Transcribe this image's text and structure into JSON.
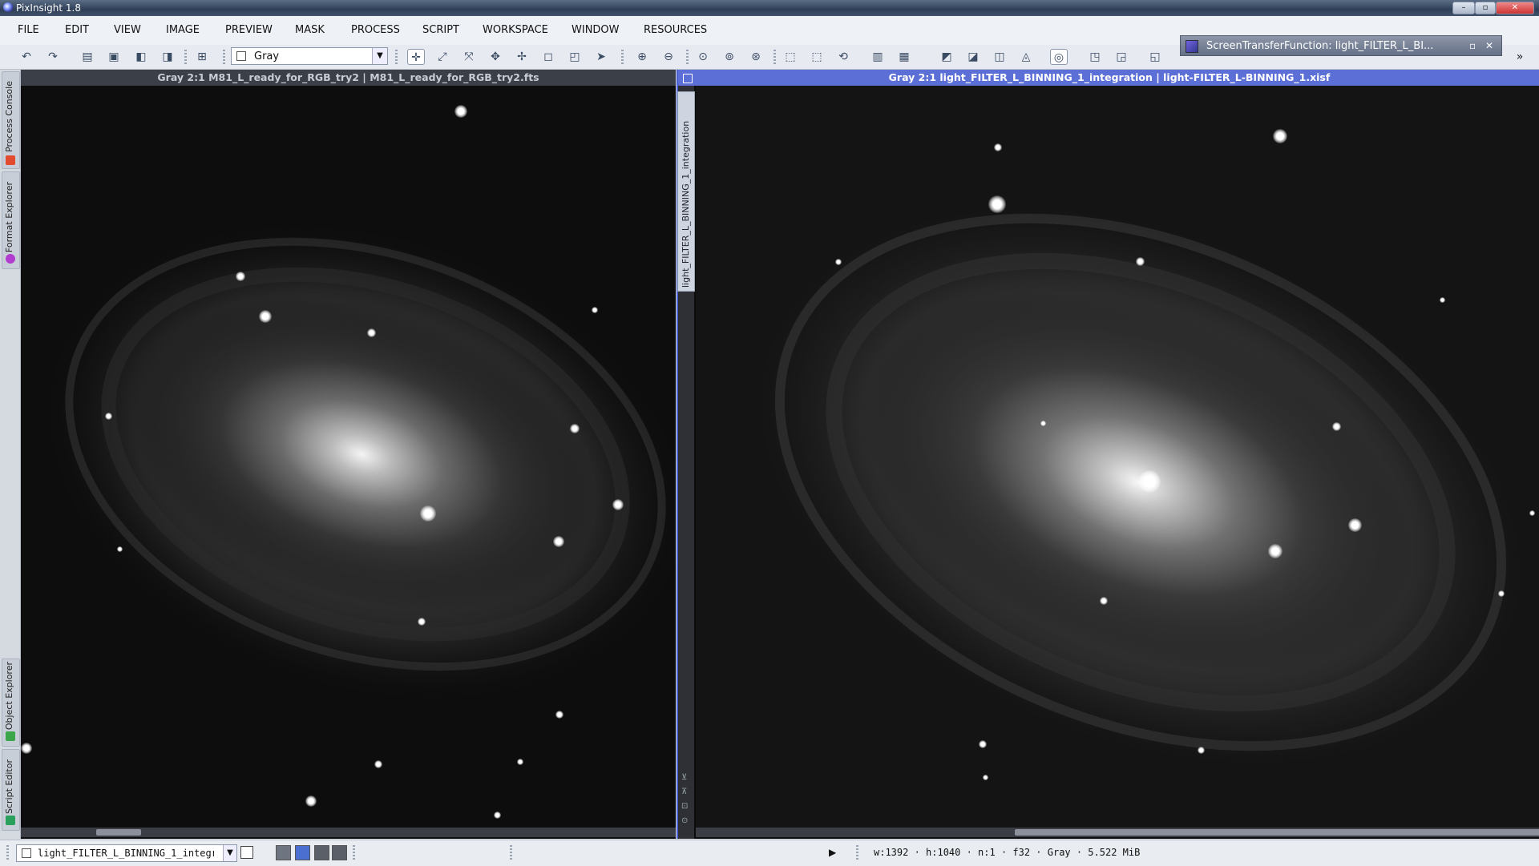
{
  "app": {
    "title": "PixInsight 1.8"
  },
  "window_controls": {
    "minimize": "–",
    "maximize": "▫",
    "close": "✕"
  },
  "menu": [
    "FILE",
    "EDIT",
    "VIEW",
    "IMAGE",
    "PREVIEW",
    "MASK",
    "PROCESS",
    "SCRIPT",
    "WORKSPACE",
    "WINDOW",
    "RESOURCES"
  ],
  "toolbar": {
    "color_mode_value": "Gray",
    "overflow": "»"
  },
  "stf_window": {
    "title": "ScreenTransferFunction: light_FILTER_L_BI..."
  },
  "side_tabs": [
    "Process Console",
    "Format Explorer",
    "Object Explorer",
    "Script Editor"
  ],
  "views": {
    "left": {
      "title": "Gray 2:1 M81_L_ready_for_RGB_try2 | M81_L_ready_for_RGB_try2.fts"
    },
    "right": {
      "title": "Gray 2:1 light_FILTER_L_BINNING_1_integration | light-FILTER_L-BINNING_1.xisf",
      "side_tab": "light_FILTER_L_BINNING_1_integration"
    }
  },
  "statusbar": {
    "view_selector": "light_FILTER_L_BINNING_1_integr",
    "info": "w:1392 · h:1040 · n:1 · f32 · Gray · 5.522 MiB",
    "play": "▶"
  },
  "colors": {
    "accent": "#4a5fd0",
    "active_title": "#5b6fd6",
    "inactive_title": "#3b3f47"
  }
}
